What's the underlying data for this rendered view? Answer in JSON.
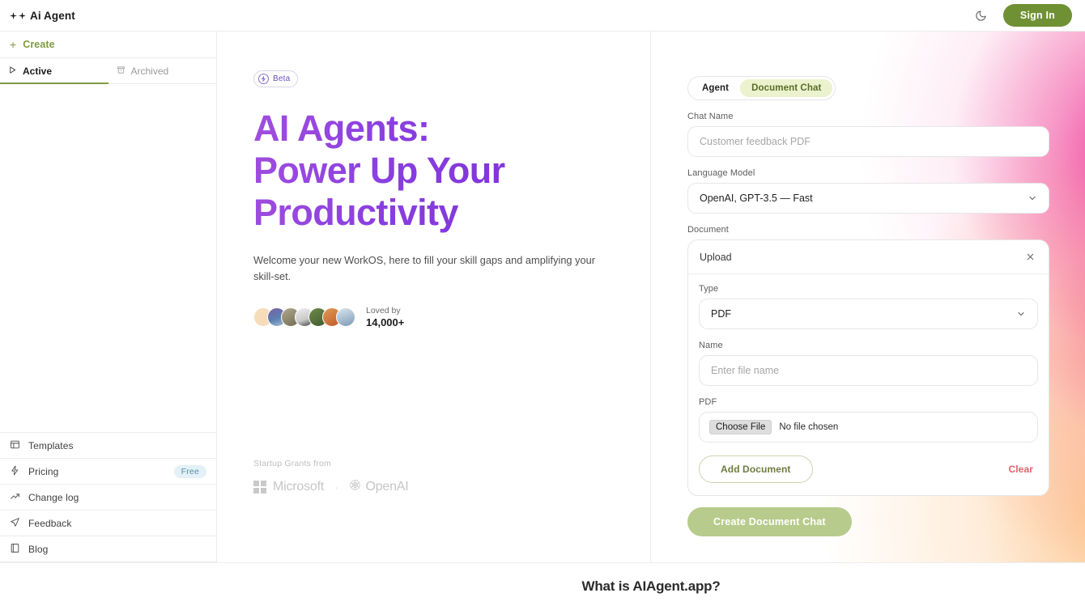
{
  "topbar": {
    "brand": "Ai Agent",
    "sparkle_glyph": "✦",
    "theme_toggle_icon": "moon-icon",
    "signin_label": "Sign In"
  },
  "sidebar": {
    "create_label": "Create",
    "create_icon": "plus-icon",
    "tabs": [
      {
        "label": "Active",
        "icon": "play-triangle-icon",
        "active": true
      },
      {
        "label": "Archived",
        "icon": "archive-box-icon",
        "active": false
      }
    ],
    "links": [
      {
        "label": "Templates",
        "icon": "layout-panel-icon",
        "badge": ""
      },
      {
        "label": "Pricing",
        "icon": "bolt-icon",
        "badge": "Free"
      },
      {
        "label": "Change log",
        "icon": "trend-up-icon",
        "badge": ""
      },
      {
        "label": "Feedback",
        "icon": "paper-plane-icon",
        "badge": ""
      },
      {
        "label": "Blog",
        "icon": "book-icon",
        "badge": ""
      }
    ]
  },
  "hero": {
    "beta_badge": "Beta",
    "beta_icon": "bolt-circle-icon",
    "title_line1": "AI Agents:",
    "title_line2": "Power Up Your",
    "title_line3": "Productivity",
    "subtitle": "Welcome your new WorkOS, here to fill your skill gaps and amplifying your skill-set.",
    "loved_by_label": "Loved by",
    "loved_by_count": "14,000+",
    "avatar_colors": [
      "#f7dcba",
      "#6f7fae",
      "#8b8470",
      "#cfcfcf",
      "#5d7546",
      "#d9823f",
      "#a9c2d6"
    ],
    "grants_label": "Startup Grants from",
    "grant_logos": [
      "Microsoft",
      "OpenAI"
    ],
    "grant_separator": "·"
  },
  "form": {
    "tabs": [
      {
        "label": "Agent",
        "active": false
      },
      {
        "label": "Document Chat",
        "active": true
      }
    ],
    "chat_name": {
      "label": "Chat Name",
      "value": "",
      "placeholder": "Customer feedback PDF"
    },
    "language_model": {
      "label": "Language Model",
      "value": "OpenAI, GPT-3.5 — Fast",
      "chevron_icon": "chevron-down-icon"
    },
    "document": {
      "label": "Document",
      "card_title": "Upload",
      "close_icon": "close-icon",
      "type": {
        "label": "Type",
        "value": "PDF",
        "chevron_icon": "chevron-down-icon"
      },
      "name": {
        "label": "Name",
        "value": "",
        "placeholder": "Enter file name"
      },
      "file": {
        "label": "PDF",
        "button": "Choose File",
        "status": "No file chosen"
      },
      "add_label": "Add Document",
      "clear_label": "Clear"
    },
    "submit_label": "Create Document Chat"
  },
  "bottom": {
    "heading": "What is AIAgent.app?"
  },
  "colors": {
    "accent_green": "#7f9b43",
    "signin_green": "#6f9134",
    "heading_purple": "#8a3fe0",
    "clear_red": "#e4636a",
    "badge_blue_bg": "#e3f1f7",
    "pill_active_bg": "#ecf2cd",
    "gradient_pink": "#ec138e",
    "gradient_peach": "#fcb978"
  }
}
